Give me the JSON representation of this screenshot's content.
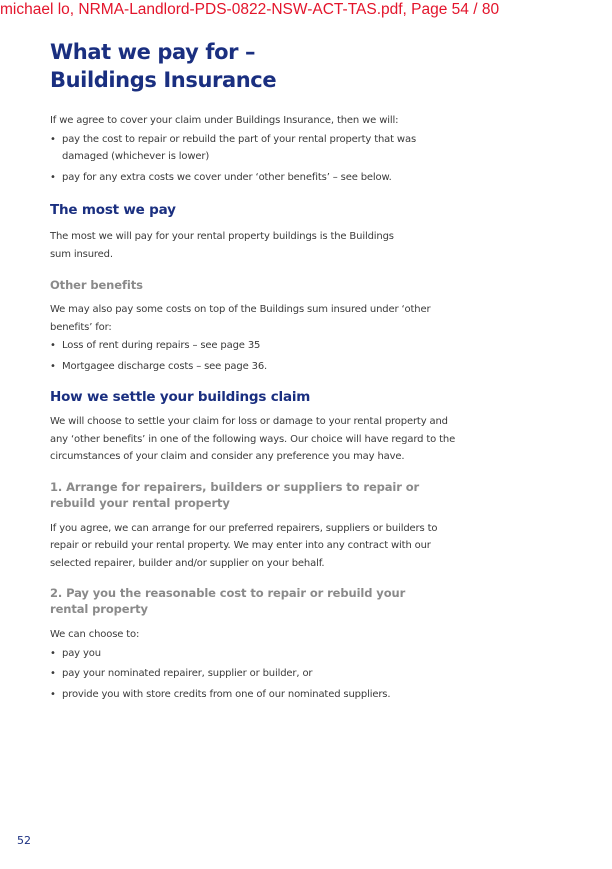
{
  "watermark": "michael lo, NRMA-Landlord-PDS-0822-NSW-ACT-TAS.pdf, Page 54 / 80",
  "title": {
    "line1": "What we pay for –",
    "line2": "Buildings Insurance"
  },
  "intro": {
    "text": "If we agree to cover your claim under Buildings Insurance, then we will:",
    "bullets": [
      "pay the cost to repair or rebuild the part of your rental property that was damaged (whichever is lower)",
      "pay for any extra costs we cover under ‘other benefits’ – see below."
    ]
  },
  "most_we_pay": {
    "heading": "The most we pay",
    "text": "The most we will pay for your rental property buildings is the Buildings sum insured."
  },
  "other_benefits": {
    "heading": "Other benefits",
    "text": "We may also pay some costs on top of the Buildings sum insured under ‘other benefits’ for:",
    "bullets": [
      "Loss of rent during repairs – see page 35",
      "Mortgagee discharge costs – see page 36."
    ]
  },
  "settle_claim": {
    "heading": "How we settle your buildings claim",
    "text": "We will choose to settle your claim for loss or damage to your rental property and any ‘other benefits’ in one of the following ways. Our choice will have regard to the circumstances of your claim and consider any preference you may have."
  },
  "option1": {
    "heading": "1. Arrange for repairers, builders or suppliers to repair or rebuild your rental property",
    "text": "If you agree, we can arrange for our preferred repairers, suppliers or builders to repair or rebuild your rental property. We may enter into any contract with our selected repairer, builder and/or supplier on your behalf."
  },
  "option2": {
    "heading": "2. Pay you the reasonable cost to repair or rebuild your rental property",
    "text": "We can choose to:",
    "bullets": [
      "pay you",
      "pay your nominated repairer, supplier or builder, or",
      "provide you with store credits from one of our nominated suppliers."
    ]
  },
  "page_number": "52",
  "colors": {
    "heading_blue": "#1a2f80",
    "subheading_grey": "#8a8a8a",
    "watermark_red": "#e3142b"
  }
}
